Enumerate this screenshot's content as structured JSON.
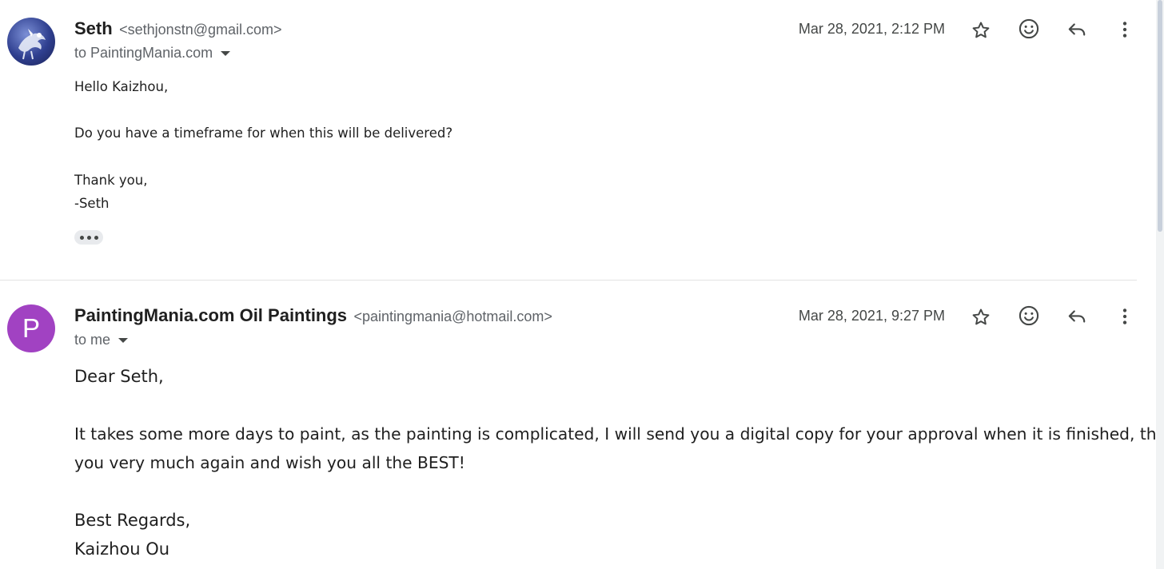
{
  "messages": [
    {
      "sender_name": "Seth",
      "sender_email": "<sethjonstn@gmail.com>",
      "recipient": "to PaintingMania.com",
      "date": "Mar 28, 2021, 2:12 PM",
      "avatar_letter": "",
      "body": {
        "greeting": "Hello Kaizhou,",
        "line1": "Do you have a timeframe for when this will be delivered?",
        "closing": "Thank you,",
        "signature": "-Seth"
      }
    },
    {
      "sender_name": "PaintingMania.com Oil Paintings",
      "sender_email": "<paintingmania@hotmail.com>",
      "recipient": "to me",
      "date": "Mar 28, 2021, 9:27 PM",
      "avatar_letter": "P",
      "body": {
        "greeting": "Dear Seth,",
        "line1": "It takes some more days to paint, as the painting is complicated, I will send you a digital copy for your approval when it is finished, thank",
        "line2": "you very much again and wish you all the BEST!",
        "closing": "Best Regards,",
        "signature": "Kaizhou Ou"
      }
    }
  ],
  "icons": {
    "star": "star-icon",
    "emoji": "emoji-icon",
    "reply": "reply-icon",
    "more": "more-vert-icon",
    "caret": "chevron-down-icon",
    "ellipsis": "show-trimmed-content-icon"
  },
  "colors": {
    "avatar_p": "#a142c2",
    "avatar_photo": "#2f3f8f",
    "icon": "#444746",
    "secondary_text": "#5f6368"
  }
}
